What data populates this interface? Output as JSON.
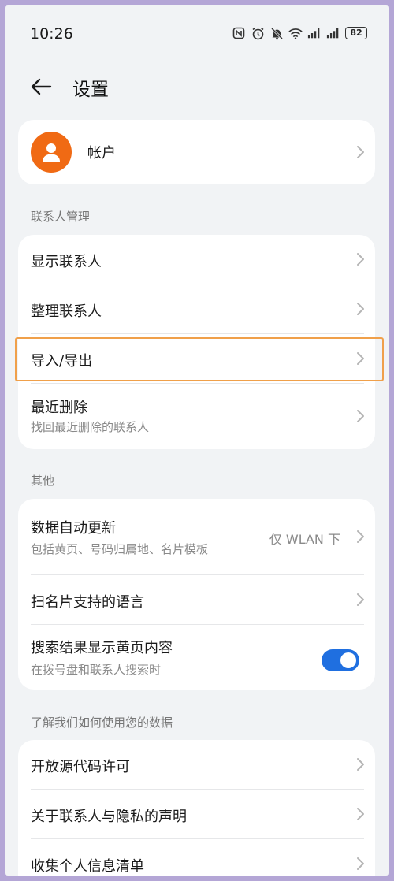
{
  "status_bar": {
    "time": "10:26",
    "battery": "82",
    "icons": [
      "nfc-icon",
      "alarm-icon",
      "mute-icon",
      "wifi-icon",
      "signal-icon",
      "signal-icon",
      "battery-icon"
    ]
  },
  "header": {
    "title": "设置",
    "back_icon": "arrow-left-icon"
  },
  "account": {
    "label": "帐户",
    "avatar_icon": "person-icon",
    "avatar_color": "#f06a14"
  },
  "sections": {
    "contacts_management": {
      "label": "联系人管理",
      "items": [
        {
          "title": "显示联系人"
        },
        {
          "title": "整理联系人"
        },
        {
          "title": "导入/导出"
        },
        {
          "title": "最近删除",
          "subtitle": "找回最近删除的联系人"
        }
      ]
    },
    "others": {
      "label": "其他",
      "items": [
        {
          "title": "数据自动更新",
          "subtitle": "包括黄页、号码归属地、名片模板",
          "value": "仅 WLAN 下"
        },
        {
          "title": "扫名片支持的语言"
        },
        {
          "title": "搜索结果显示黄页内容",
          "subtitle": "在拨号盘和联系人搜索时",
          "toggle": true
        }
      ]
    },
    "data_usage": {
      "label": "了解我们如何使用您的数据",
      "items": [
        {
          "title": "开放源代码许可"
        },
        {
          "title": "关于联系人与隐私的声明"
        },
        {
          "title": "收集个人信息清单"
        }
      ]
    }
  },
  "colors": {
    "accent": "#1f6fe0",
    "highlight": "#f0a04a",
    "background": "#f1f3f5",
    "frame": "#b4a6d6"
  }
}
